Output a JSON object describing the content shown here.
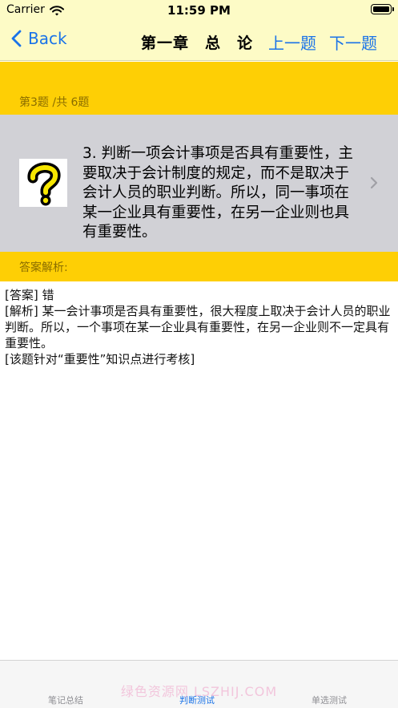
{
  "status_bar": {
    "carrier": "Carrier",
    "time": "11:59 PM",
    "wifi_icon": "wifi-icon",
    "battery_icon": "battery-icon"
  },
  "nav": {
    "back_label": "Back",
    "back_icon": "chevron-left-icon",
    "title": "第一章　总　论",
    "prev_label": "上一题",
    "next_label": "下一题"
  },
  "progress": "第3题 /共 6题",
  "question": {
    "icon": "question-mark-icon",
    "text": "3.  判断一项会计事项是否具有重要性，主要取决于会计制度的规定，而不是取决于会计人员的职业判断。所以，同一事项在某一企业具有重要性，在另一企业则也具有重要性。",
    "chevron_icon": "chevron-right-icon"
  },
  "answer_section": {
    "title": "答案解析:",
    "lines": [
      "[答案] 错",
      "[解析] 某一会计事项是否具有重要性，很大程度上取决于会计人员的职业判断。所以，一个事项在某一企业具有重要性，在另一企业则不一定具有重要性。",
      "[该题针对“重要性”知识点进行考核]"
    ]
  },
  "tabbar": {
    "watermark": "绿色资源网 LSZHIJ.COM",
    "tabs": [
      {
        "label": "笔记总结",
        "active": false
      },
      {
        "label": "判断测试",
        "active": true
      },
      {
        "label": "单选测试",
        "active": false
      }
    ]
  },
  "colors": {
    "accent": "#1a73e8",
    "yellow": "#fecf05",
    "nav_bg": "#fdfbc6",
    "question_bg": "#d1d1d6"
  }
}
